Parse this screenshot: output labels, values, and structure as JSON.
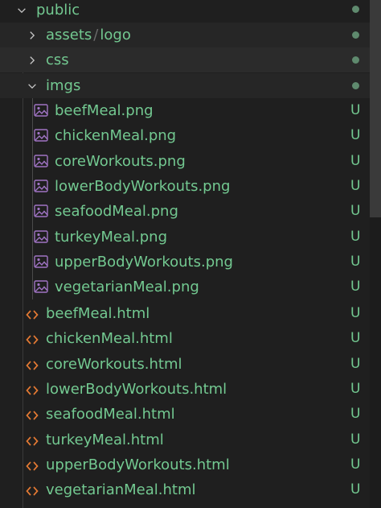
{
  "root": {
    "label": "public",
    "expanded": true
  },
  "folders": [
    {
      "label_a": "assets",
      "label_sep": "/",
      "label_b": "logo",
      "expanded": false
    },
    {
      "label": "css",
      "expanded": false
    },
    {
      "label": "imgs",
      "expanded": true
    }
  ],
  "image_files": [
    {
      "name": "beefMeal.png",
      "badge": "U"
    },
    {
      "name": "chickenMeal.png",
      "badge": "U"
    },
    {
      "name": "coreWorkouts.png",
      "badge": "U"
    },
    {
      "name": "lowerBodyWorkouts.png",
      "badge": "U"
    },
    {
      "name": "seafoodMeal.png",
      "badge": "U"
    },
    {
      "name": "turkeyMeal.png",
      "badge": "U"
    },
    {
      "name": "upperBodyWorkouts.png",
      "badge": "U"
    },
    {
      "name": "vegetarianMeal.png",
      "badge": "U"
    }
  ],
  "html_files": [
    {
      "name": "beefMeal.html",
      "badge": "U"
    },
    {
      "name": "chickenMeal.html",
      "badge": "U"
    },
    {
      "name": "coreWorkouts.html",
      "badge": "U"
    },
    {
      "name": "lowerBodyWorkouts.html",
      "badge": "U"
    },
    {
      "name": "seafoodMeal.html",
      "badge": "U"
    },
    {
      "name": "turkeyMeal.html",
      "badge": "U"
    },
    {
      "name": "upperBodyWorkouts.html",
      "badge": "U"
    },
    {
      "name": "vegetarianMeal.html",
      "badge": "U"
    }
  ],
  "icons": {
    "folder_chevron_expanded": "chevron-down-icon",
    "folder_chevron_collapsed": "chevron-right-icon",
    "image_file": "image-file-icon",
    "html_file": "html-file-icon"
  },
  "colors": {
    "untracked_text": "#73c991",
    "html_icon": "#e37933",
    "image_icon": "#a074c4",
    "modified_dot": "#5f8a6e",
    "background": "#1f1f1f"
  }
}
